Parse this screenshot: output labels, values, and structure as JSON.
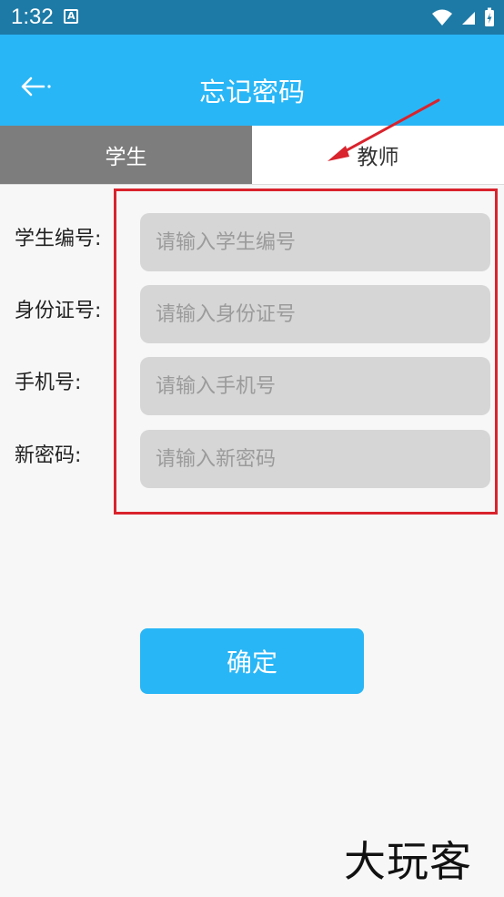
{
  "status_bar": {
    "time": "1:32",
    "app_icon": "A",
    "icons": [
      "wifi-icon",
      "cellular-signal-icon",
      "battery-charging-icon"
    ]
  },
  "app_bar": {
    "back_icon": "arrow-left-icon",
    "title": "忘记密码",
    "color": "#29b6f6"
  },
  "tabs": [
    {
      "label": "学生",
      "selected": false
    },
    {
      "label": "教师",
      "selected": true
    }
  ],
  "form": {
    "fields": [
      {
        "label": "学生编号:",
        "placeholder": "请输入学生编号",
        "value": ""
      },
      {
        "label": "身份证号:",
        "placeholder": "请输入身份证号",
        "value": ""
      },
      {
        "label": "手机号:",
        "placeholder": "请输入手机号",
        "value": ""
      },
      {
        "label": "新密码:",
        "placeholder": "请输入新密码",
        "value": ""
      }
    ]
  },
  "confirm_button": {
    "label": "确定"
  },
  "annotation": {
    "highlight_color": "#d9232d"
  },
  "watermark": "大玩客"
}
